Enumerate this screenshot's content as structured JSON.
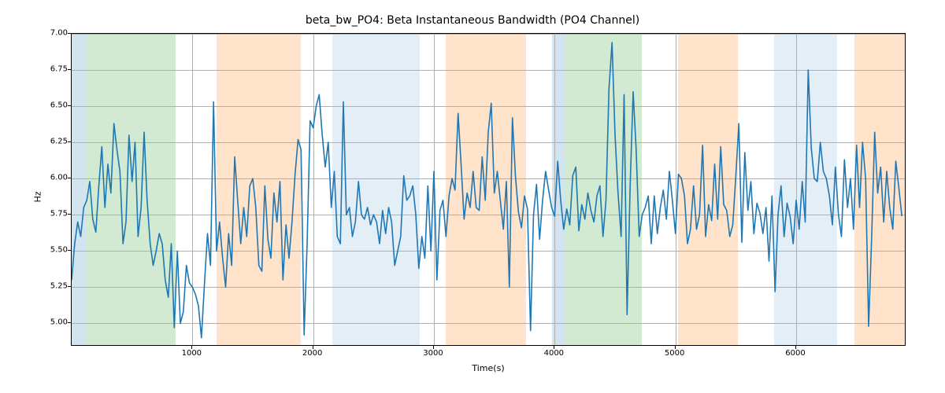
{
  "chart_data": {
    "type": "line",
    "title": "beta_bw_PO4: Beta Instantaneous Bandwidth (PO4 Channel)",
    "xlabel": "Time(s)",
    "ylabel": "Hz",
    "xlim": [
      0,
      6900
    ],
    "ylim": [
      4.85,
      7.0
    ],
    "xticks": [
      1000,
      2000,
      3000,
      4000,
      5000,
      6000
    ],
    "yticks": [
      5.0,
      5.25,
      5.5,
      5.75,
      6.0,
      6.25,
      6.5,
      6.75,
      7.0
    ],
    "xtick_labels": [
      "1000",
      "2000",
      "3000",
      "4000",
      "5000",
      "6000"
    ],
    "ytick_labels": [
      "5.00",
      "5.25",
      "5.50",
      "5.75",
      "6.00",
      "6.25",
      "6.50",
      "6.75",
      "7.00"
    ],
    "regions": [
      {
        "start": 0,
        "end": 120,
        "color": "blue"
      },
      {
        "start": 120,
        "end": 860,
        "color": "green"
      },
      {
        "start": 1200,
        "end": 1900,
        "color": "orange"
      },
      {
        "start": 2160,
        "end": 2880,
        "color": "ltblue"
      },
      {
        "start": 3100,
        "end": 3760,
        "color": "orange"
      },
      {
        "start": 3980,
        "end": 4080,
        "color": "blue"
      },
      {
        "start": 4080,
        "end": 4720,
        "color": "green"
      },
      {
        "start": 5020,
        "end": 5520,
        "color": "orange"
      },
      {
        "start": 5820,
        "end": 6340,
        "color": "ltblue"
      },
      {
        "start": 6480,
        "end": 6900,
        "color": "orange"
      }
    ],
    "series": [
      {
        "name": "beta_bw_PO4",
        "x": [
          0,
          25,
          50,
          75,
          100,
          125,
          150,
          175,
          200,
          225,
          250,
          275,
          300,
          325,
          350,
          375,
          400,
          425,
          450,
          475,
          500,
          525,
          550,
          575,
          600,
          625,
          650,
          675,
          700,
          725,
          750,
          775,
          800,
          825,
          850,
          875,
          900,
          925,
          950,
          975,
          1000,
          1025,
          1050,
          1075,
          1100,
          1125,
          1150,
          1175,
          1200,
          1225,
          1250,
          1275,
          1300,
          1325,
          1350,
          1375,
          1400,
          1425,
          1450,
          1475,
          1500,
          1525,
          1550,
          1575,
          1600,
          1625,
          1650,
          1675,
          1700,
          1725,
          1750,
          1775,
          1800,
          1825,
          1850,
          1875,
          1900,
          1925,
          1950,
          1975,
          2000,
          2025,
          2050,
          2075,
          2100,
          2125,
          2150,
          2175,
          2200,
          2225,
          2250,
          2275,
          2300,
          2325,
          2350,
          2375,
          2400,
          2425,
          2450,
          2475,
          2500,
          2525,
          2550,
          2575,
          2600,
          2625,
          2650,
          2675,
          2700,
          2725,
          2750,
          2775,
          2800,
          2825,
          2850,
          2875,
          2900,
          2925,
          2950,
          2975,
          3000,
          3025,
          3050,
          3075,
          3100,
          3125,
          3150,
          3175,
          3200,
          3225,
          3250,
          3275,
          3300,
          3325,
          3350,
          3375,
          3400,
          3425,
          3450,
          3475,
          3500,
          3525,
          3550,
          3575,
          3600,
          3625,
          3650,
          3675,
          3700,
          3725,
          3750,
          3775,
          3800,
          3825,
          3850,
          3875,
          3900,
          3925,
          3950,
          3975,
          4000,
          4025,
          4050,
          4075,
          4100,
          4125,
          4150,
          4175,
          4200,
          4225,
          4250,
          4275,
          4300,
          4325,
          4350,
          4375,
          4400,
          4425,
          4450,
          4475,
          4500,
          4525,
          4550,
          4575,
          4600,
          4625,
          4650,
          4675,
          4700,
          4725,
          4750,
          4775,
          4800,
          4825,
          4850,
          4875,
          4900,
          4925,
          4950,
          4975,
          5000,
          5025,
          5050,
          5075,
          5100,
          5125,
          5150,
          5175,
          5200,
          5225,
          5250,
          5275,
          5300,
          5325,
          5350,
          5375,
          5400,
          5425,
          5450,
          5475,
          5500,
          5525,
          5550,
          5575,
          5600,
          5625,
          5650,
          5675,
          5700,
          5725,
          5750,
          5775,
          5800,
          5825,
          5850,
          5875,
          5900,
          5925,
          5950,
          5975,
          6000,
          6025,
          6050,
          6075,
          6100,
          6125,
          6150,
          6175,
          6200,
          6225,
          6250,
          6275,
          6300,
          6325,
          6350,
          6375,
          6400,
          6425,
          6450,
          6475,
          6500,
          6525,
          6550,
          6575,
          6600,
          6625,
          6650,
          6675,
          6700,
          6725,
          6750,
          6775,
          6800,
          6825,
          6850,
          6875
        ],
        "values": [
          5.3,
          5.55,
          5.7,
          5.6,
          5.8,
          5.85,
          5.98,
          5.72,
          5.63,
          5.95,
          6.22,
          5.8,
          6.1,
          5.9,
          6.38,
          6.2,
          6.05,
          5.55,
          5.7,
          6.3,
          5.98,
          6.25,
          5.6,
          5.8,
          6.32,
          5.85,
          5.55,
          5.4,
          5.5,
          5.62,
          5.55,
          5.3,
          5.18,
          5.55,
          4.97,
          5.5,
          5.0,
          5.08,
          5.4,
          5.28,
          5.25,
          5.2,
          5.12,
          4.9,
          5.28,
          5.62,
          5.4,
          6.53,
          5.5,
          5.7,
          5.45,
          5.25,
          5.62,
          5.4,
          6.15,
          5.85,
          5.55,
          5.8,
          5.6,
          5.95,
          6.0,
          5.8,
          5.4,
          5.36,
          5.95,
          5.58,
          5.45,
          5.9,
          5.7,
          5.98,
          5.3,
          5.68,
          5.45,
          5.7,
          6.03,
          6.27,
          6.2,
          4.92,
          5.55,
          6.4,
          6.35,
          6.5,
          6.58,
          6.3,
          6.08,
          6.25,
          5.8,
          6.05,
          5.6,
          5.55,
          6.53,
          5.75,
          5.8,
          5.6,
          5.7,
          5.98,
          5.75,
          5.72,
          5.8,
          5.68,
          5.75,
          5.7,
          5.55,
          5.78,
          5.62,
          5.8,
          5.7,
          5.4,
          5.5,
          5.6,
          6.02,
          5.85,
          5.88,
          5.95,
          5.75,
          5.38,
          5.6,
          5.45,
          5.95,
          5.5,
          6.05,
          5.3,
          5.78,
          5.85,
          5.6,
          5.88,
          6.0,
          5.92,
          6.45,
          6.1,
          5.72,
          5.9,
          5.8,
          6.05,
          5.8,
          5.78,
          6.15,
          5.85,
          6.32,
          6.52,
          5.9,
          6.05,
          5.85,
          5.65,
          5.98,
          5.25,
          6.42,
          6.02,
          5.77,
          5.66,
          5.88,
          5.79,
          4.95,
          5.75,
          5.96,
          5.58,
          5.85,
          6.05,
          5.92,
          5.8,
          5.74,
          6.12,
          5.85,
          5.65,
          5.79,
          5.68,
          6.02,
          6.08,
          5.64,
          5.82,
          5.72,
          5.9,
          5.78,
          5.7,
          5.88,
          5.95,
          5.6,
          5.85,
          6.62,
          6.94,
          6.3,
          5.9,
          5.6,
          6.58,
          5.06,
          5.95,
          6.6,
          6.2,
          5.6,
          5.75,
          5.8,
          5.88,
          5.55,
          5.88,
          5.62,
          5.8,
          5.92,
          5.72,
          6.05,
          5.85,
          5.62,
          6.03,
          6.0,
          5.88,
          5.55,
          5.65,
          5.95,
          5.65,
          5.75,
          6.23,
          5.6,
          5.82,
          5.71,
          6.1,
          5.72,
          6.22,
          5.82,
          5.78,
          5.6,
          5.68,
          6.01,
          6.38,
          5.56,
          6.18,
          5.78,
          5.98,
          5.62,
          5.83,
          5.76,
          5.62,
          5.8,
          5.43,
          5.88,
          5.22,
          5.75,
          5.95,
          5.6,
          5.83,
          5.74,
          5.55,
          5.85,
          5.65,
          5.98,
          5.7,
          6.75,
          6.21,
          6.0,
          5.98,
          6.25,
          6.05,
          6.0,
          5.88,
          5.68,
          6.08,
          5.75,
          5.6,
          6.13,
          5.8,
          6.0,
          5.65,
          6.23,
          5.8,
          6.25,
          6.0,
          4.98,
          5.58,
          6.32,
          5.9,
          6.08,
          5.7,
          6.05,
          5.8,
          5.65,
          6.12,
          5.94,
          5.74
        ]
      }
    ]
  }
}
